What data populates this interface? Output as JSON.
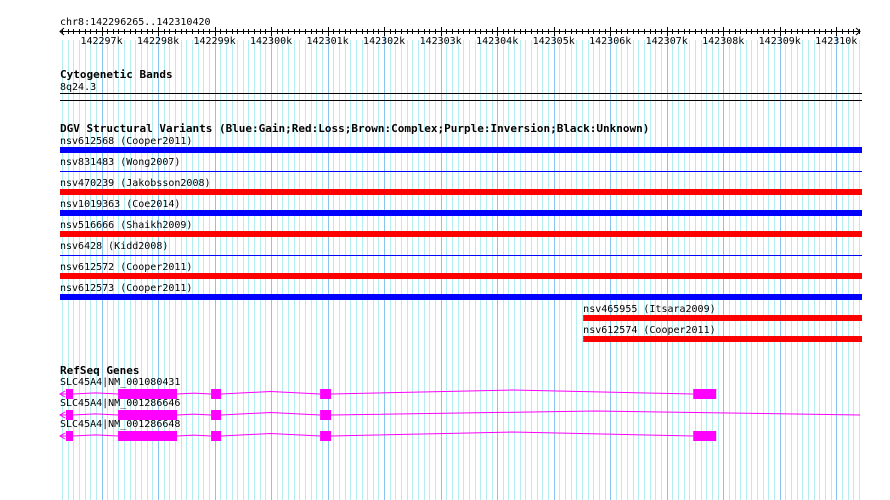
{
  "view": {
    "chrom": "chr8",
    "start": 142296265,
    "end": 142310420,
    "location_label": "chr8:142296265..142310420"
  },
  "ruler": {
    "tick_labels": [
      "142297k",
      "142298k",
      "142299k",
      "142300k",
      "142301k",
      "142302k",
      "142303k",
      "142304k",
      "142305k",
      "142306k",
      "142307k",
      "142308k",
      "142309k",
      "142310k"
    ]
  },
  "cytobands": {
    "title": "Cytogenetic Bands",
    "band": "8q24.3"
  },
  "dgv": {
    "title": "DGV Structural Variants (Blue:Gain;Red:Loss;Brown:Complex;Purple:Inversion;Black:Unknown)",
    "colors": {
      "gain": "#0000ff",
      "loss": "#ff0000"
    },
    "variants": [
      {
        "label": "nsv612568 (Cooper2011)",
        "type": "gain",
        "style": "bar",
        "start": 142296265,
        "end": 142310420
      },
      {
        "label": "nsv831483 (Wong2007)",
        "type": "gain",
        "style": "line",
        "start": 142296265,
        "end": 142310420
      },
      {
        "label": "nsv470239 (Jakobsson2008)",
        "type": "loss",
        "style": "bar",
        "start": 142296265,
        "end": 142310420
      },
      {
        "label": "nsv1019363 (Coe2014)",
        "type": "gain",
        "style": "bar",
        "start": 142296265,
        "end": 142310420
      },
      {
        "label": "nsv516666 (Shaikh2009)",
        "type": "loss",
        "style": "bar",
        "start": 142296265,
        "end": 142310420
      },
      {
        "label": "nsv6428 (Kidd2008)",
        "type": "gain",
        "style": "line",
        "start": 142296265,
        "end": 142310420
      },
      {
        "label": "nsv612572 (Cooper2011)",
        "type": "loss",
        "style": "bar",
        "start": 142296265,
        "end": 142310420
      },
      {
        "label": "nsv612573 (Cooper2011)",
        "type": "gain",
        "style": "bar",
        "start": 142296265,
        "end": 142310420
      },
      {
        "label": "nsv465955 (Itsara2009)",
        "type": "loss",
        "style": "bar",
        "start": 142305522,
        "end": 142310420
      },
      {
        "label": "nsv612574 (Cooper2011)",
        "type": "loss",
        "style": "bar",
        "start": 142305522,
        "end": 142310420
      }
    ]
  },
  "refseq": {
    "title": "RefSeq Genes",
    "color": "#ff00ff",
    "genes": [
      {
        "label": "SLC45A4|NM_001080431",
        "start": 142296265,
        "end": 142307876,
        "strand": "-",
        "exons": [
          [
            142296371,
            142296495
          ],
          [
            142297292,
            142298336
          ],
          [
            142298938,
            142299115
          ],
          [
            142300867,
            142301061
          ],
          [
            142307469,
            142307876
          ]
        ]
      },
      {
        "label": "SLC45A4|NM_001286646",
        "start": 142296265,
        "end": 142310420,
        "strand": "-",
        "exons": [
          [
            142296371,
            142296495
          ],
          [
            142297292,
            142298336
          ],
          [
            142298938,
            142299115
          ],
          [
            142300867,
            142301061
          ]
        ]
      },
      {
        "label": "SLC45A4|NM_001286648",
        "start": 142296265,
        "end": 142307876,
        "strand": "-",
        "exons": [
          [
            142296371,
            142296495
          ],
          [
            142297292,
            142298336
          ],
          [
            142298938,
            142299115
          ],
          [
            142300867,
            142301061
          ],
          [
            142307469,
            142307876
          ]
        ]
      }
    ]
  }
}
